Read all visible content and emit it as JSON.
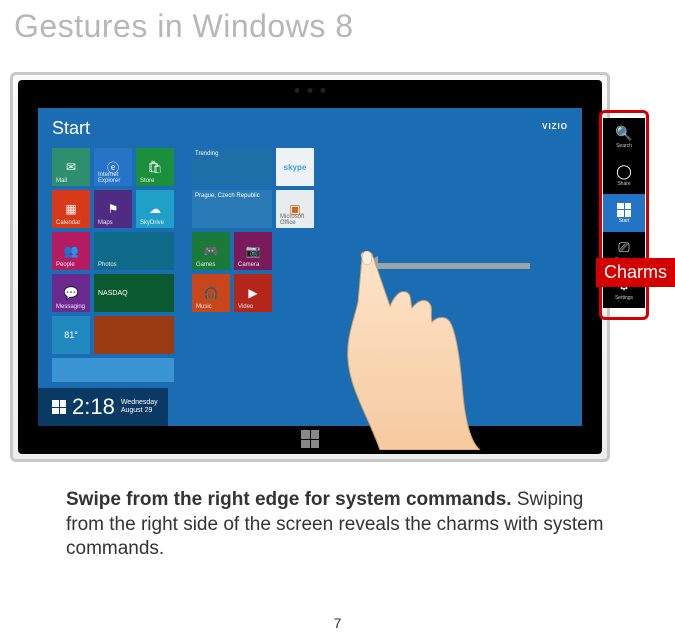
{
  "title": "Gestures in Windows 8",
  "screen": {
    "start_label": "Start",
    "brand": "VIZIO"
  },
  "tiles": {
    "mail": "Mail",
    "ie": "Internet Explorer",
    "store": "Store",
    "calendar": "Calendar",
    "maps": "Maps",
    "skydrive": "SkyDrive",
    "people": "People",
    "photos": "Photos",
    "messaging": "Messaging",
    "finance": "NASDAQ",
    "weather": "81°",
    "news": "",
    "trending": "Trending",
    "prague": "Prague, Czech Republic",
    "games": "Games",
    "camera": "Camera",
    "music": "Music",
    "video": "Video",
    "office": "Microsoft Office",
    "skype": "skype"
  },
  "clock": {
    "time": "2:18",
    "day": "Wednesday",
    "date": "August 29"
  },
  "charms": {
    "label": "Charms",
    "search": "Search",
    "share": "Share",
    "start": "Start",
    "devices": "Devices",
    "settings": "Settings"
  },
  "instruction": {
    "bold": "Swipe from the right edge for system commands.",
    "body": "Swiping from the right side of the screen reveals the charms with system commands."
  },
  "page_number": "7"
}
